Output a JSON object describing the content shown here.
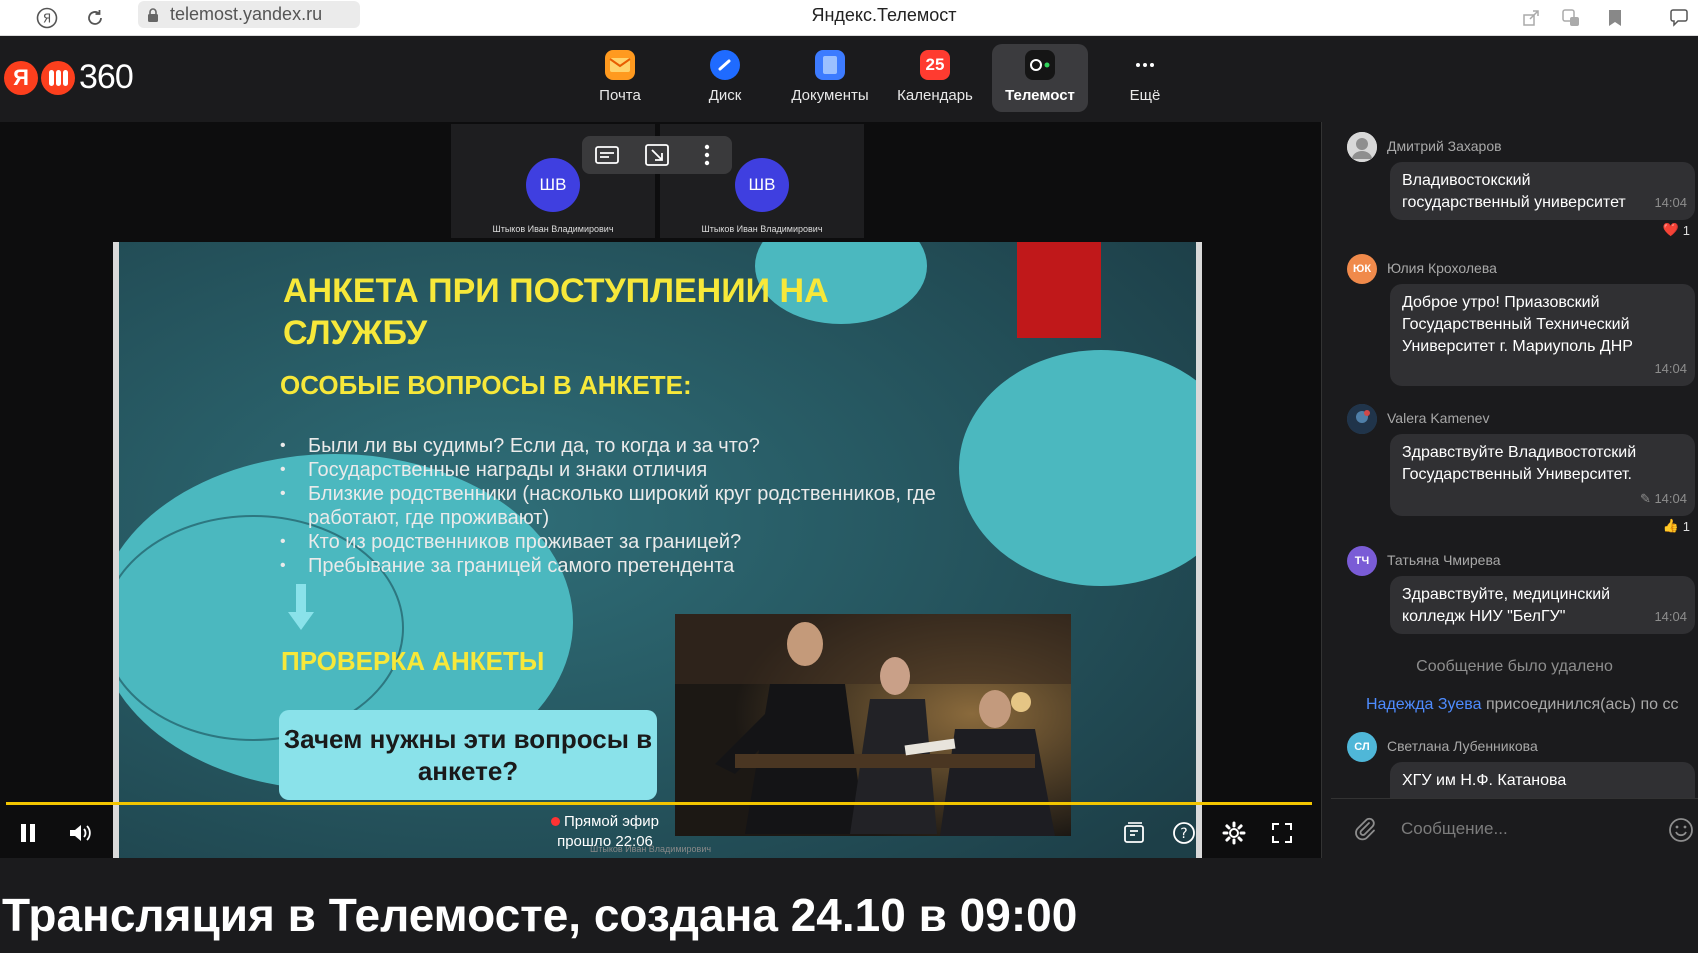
{
  "browser": {
    "url": "telemost.yandex.ru",
    "title": "Яндекс.Телемост"
  },
  "header": {
    "logo_text": "360",
    "services": [
      {
        "label": "Почта",
        "icon": "mail-icon",
        "color": "#ff9a1f"
      },
      {
        "label": "Диск",
        "icon": "disk-icon",
        "color": "#1f6bff"
      },
      {
        "label": "Документы",
        "icon": "documents-icon",
        "color": "#3d7bff"
      },
      {
        "label": "Календарь",
        "icon": "calendar-icon",
        "color": "#ff3b30",
        "badge": "25"
      },
      {
        "label": "Телемост",
        "icon": "telemost-icon",
        "color": "#151515",
        "active": true
      },
      {
        "label": "Ещё",
        "icon": "more-icon",
        "color": "transparent"
      }
    ]
  },
  "participants": [
    {
      "initials": "ШВ",
      "name": "Штыков Иван Владимирович"
    },
    {
      "initials": "ШВ",
      "name": "Штыков Иван Владимирович"
    }
  ],
  "slide": {
    "title": "АНКЕТА ПРИ ПОСТУПЛЕНИИ НА СЛУЖБУ",
    "subtitle": "ОСОБЫЕ ВОПРОСЫ В АНКЕТЕ:",
    "bullets": [
      "Были ли вы судимы? Если да, то когда и за что?",
      "Государственные награды и знаки отличия",
      "Близкие родственники (насколько широкий круг родственников, где работают, где проживают)",
      "Кто из родственников проживает за границей?",
      "Пребывание за границей самого претендента"
    ],
    "check": "ПРОВЕРКА АНКЕТЫ",
    "box": "Зачем нужны эти вопросы в анкете?",
    "colors": {
      "accent": "#f7e83a",
      "teal": "#4bb8bf",
      "box": "#8ae2ea",
      "red": "#c0181a"
    }
  },
  "player": {
    "live_label": "Прямой эфир",
    "elapsed": "прошло 22:06",
    "presenter_caption": "Штыков Иван Владимирович",
    "progress_color": "#f2c500"
  },
  "chat": {
    "messages": [
      {
        "author": "Дмитрий Захаров",
        "avatar": "photo",
        "text": "Владивостокский государственный университет",
        "time": "14:04",
        "reaction": "❤️",
        "reaction_count": "1"
      },
      {
        "author": "Юлия Крохолева",
        "avatar": "ЮК",
        "text": "Доброе утро! Приазовский Государственный Технический Университет г. Мариуполь ДНР",
        "time": "14:04"
      },
      {
        "author": "Valera Kamenev",
        "avatar": "photo",
        "text": "Здравствуйте Владивостотский Государственный Университет.",
        "time": "14:04",
        "edited": true,
        "reaction": "👍",
        "reaction_count": "1"
      },
      {
        "author": "Татьяна Чмирева",
        "avatar": "ТЧ",
        "text": "Здравствуйте, медицинский колледж НИУ \"БелГУ\"",
        "time": "14:04"
      },
      {
        "author": "Светлана Лубенникова",
        "avatar": "СЛ",
        "text": "ХГУ им Н.Ф. Катанова"
      }
    ],
    "deleted_note": "Сообщение было удалено",
    "join_name": "Надежда Зуева",
    "join_text": " присоединился(ась) по сс",
    "input_placeholder": "Сообщение..."
  },
  "page_title": "Трансляция в Телемосте, создана 24.10 в 09:00"
}
